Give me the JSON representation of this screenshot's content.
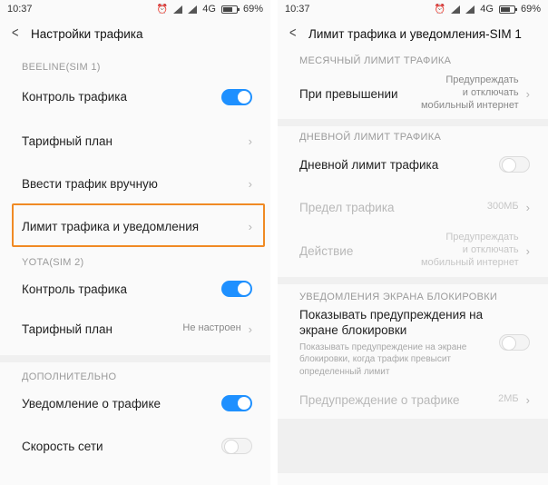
{
  "status_left": {
    "time": "10:37",
    "network": "4G",
    "battery": "69%"
  },
  "status_right": {
    "time": "10:37",
    "network": "4G",
    "battery": "69%"
  },
  "left": {
    "title": "Настройки трафика",
    "sim1_header": "BEELINE(SIM 1)",
    "sim1_items": [
      {
        "label": "Контроль трафика",
        "toggle": "on"
      },
      {
        "label": "Тарифный план"
      },
      {
        "label": "Ввести трафик вручную"
      },
      {
        "label": "Лимит трафика и уведомления"
      }
    ],
    "sim2_header": "YOTA(SIM 2)",
    "sim2_items": [
      {
        "label": "Контроль трафика",
        "toggle": "on"
      },
      {
        "label": "Тарифный план",
        "value": "Не настроен"
      }
    ],
    "extra_header": "ДОПОЛНИТЕЛЬНО",
    "extra_items": [
      {
        "label": "Уведомление о трафике",
        "toggle": "on"
      },
      {
        "label": "Скорость сети",
        "toggle": "off"
      }
    ]
  },
  "right": {
    "title": "Лимит трафика и уведомления-SIM 1",
    "monthly_header": "МЕСЯЧНЫЙ ЛИМИТ ТРАФИКА",
    "exceed_label": "При превышении",
    "exceed_value": [
      "Предупреждать",
      "и отключать",
      "мобильный интернет"
    ],
    "daily_header": "ДНЕВНОЙ ЛИМИТ ТРАФИКА",
    "daily_label": "Дневной лимит трафика",
    "limit_label": "Предел трафика",
    "limit_value": "300МБ",
    "action_label": "Действие",
    "action_value": [
      "Предупреждать",
      "и отключать",
      "мобильный интернет"
    ],
    "lock_header": "УВЕДОМЛЕНИЯ ЭКРАНА БЛОКИРОВКИ",
    "lock_label": [
      "Показывать предупреждения на",
      "экране блокировки"
    ],
    "lock_desc": [
      "Показывать предупреждение на экране",
      "блокировки, когда трафик превысит",
      "определенный лимит"
    ],
    "warn_label": "Предупреждение о трафике",
    "warn_value": "2МБ"
  },
  "colors": {
    "accent": "#1e90ff",
    "highlight": "#f08a24"
  },
  "icons": {
    "back": "back-arrow-icon",
    "chevron": "chevron-right-icon",
    "alarm": "alarm-icon",
    "signal": "signal-icon",
    "battery": "battery-icon"
  }
}
